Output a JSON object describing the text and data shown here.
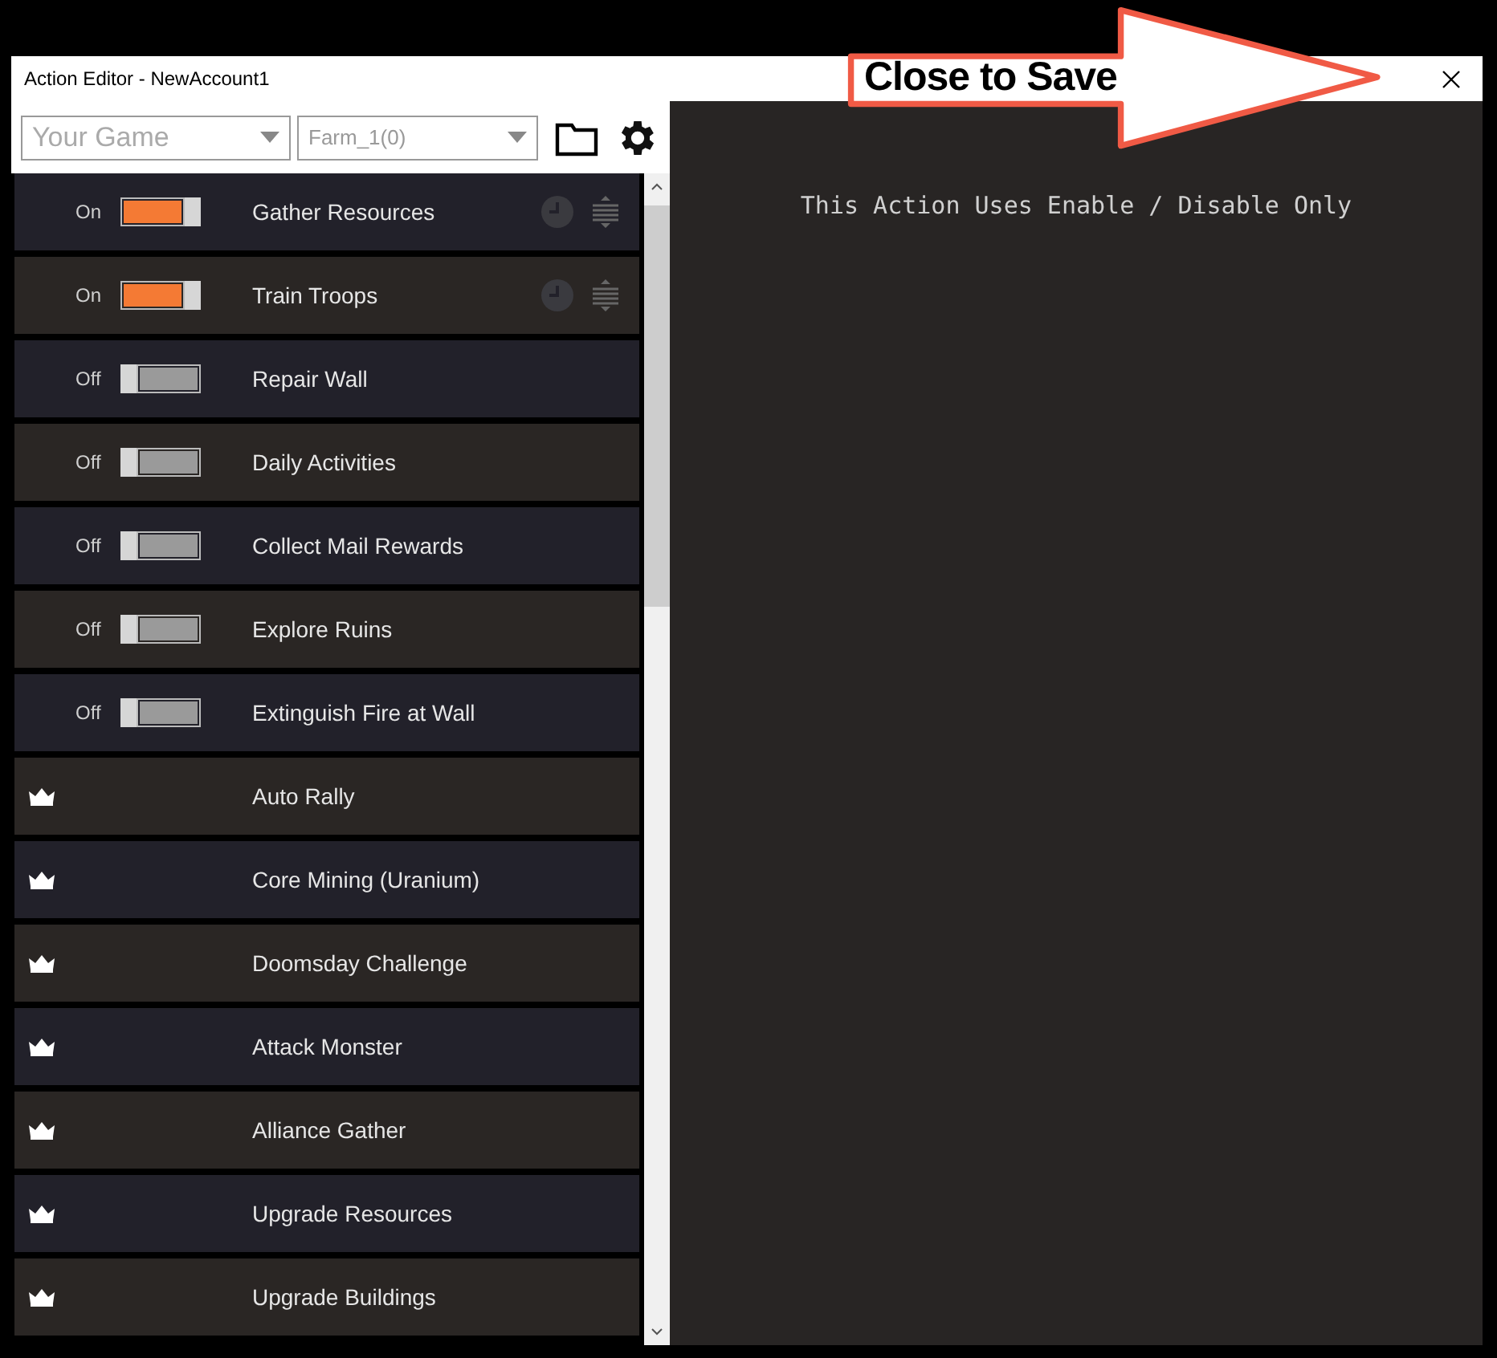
{
  "window": {
    "title": "Action Editor - NewAccount1"
  },
  "callout": {
    "text": "Close to Save"
  },
  "toolbar": {
    "game": {
      "placeholder": "Your Game"
    },
    "account": {
      "value": "Farm_1(0)"
    }
  },
  "actions": [
    {
      "kind": "toggle",
      "state_label": "On",
      "on": true,
      "name": "Gather Resources"
    },
    {
      "kind": "toggle",
      "state_label": "On",
      "on": true,
      "name": "Train Troops"
    },
    {
      "kind": "toggle",
      "state_label": "Off",
      "on": false,
      "name": "Repair Wall"
    },
    {
      "kind": "toggle",
      "state_label": "Off",
      "on": false,
      "name": "Daily Activities"
    },
    {
      "kind": "toggle",
      "state_label": "Off",
      "on": false,
      "name": "Collect Mail Rewards"
    },
    {
      "kind": "toggle",
      "state_label": "Off",
      "on": false,
      "name": "Explore Ruins"
    },
    {
      "kind": "toggle",
      "state_label": "Off",
      "on": false,
      "name": "Extinguish Fire at Wall"
    },
    {
      "kind": "premium",
      "name": "Auto Rally"
    },
    {
      "kind": "premium",
      "name": "Core Mining (Uranium)"
    },
    {
      "kind": "premium",
      "name": "Doomsday Challenge"
    },
    {
      "kind": "premium",
      "name": "Attack Monster"
    },
    {
      "kind": "premium",
      "name": "Alliance Gather"
    },
    {
      "kind": "premium",
      "name": "Upgrade Resources"
    },
    {
      "kind": "premium",
      "name": "Upgrade Buildings"
    }
  ],
  "detail": {
    "message": "This Action Uses Enable / Disable Only"
  }
}
